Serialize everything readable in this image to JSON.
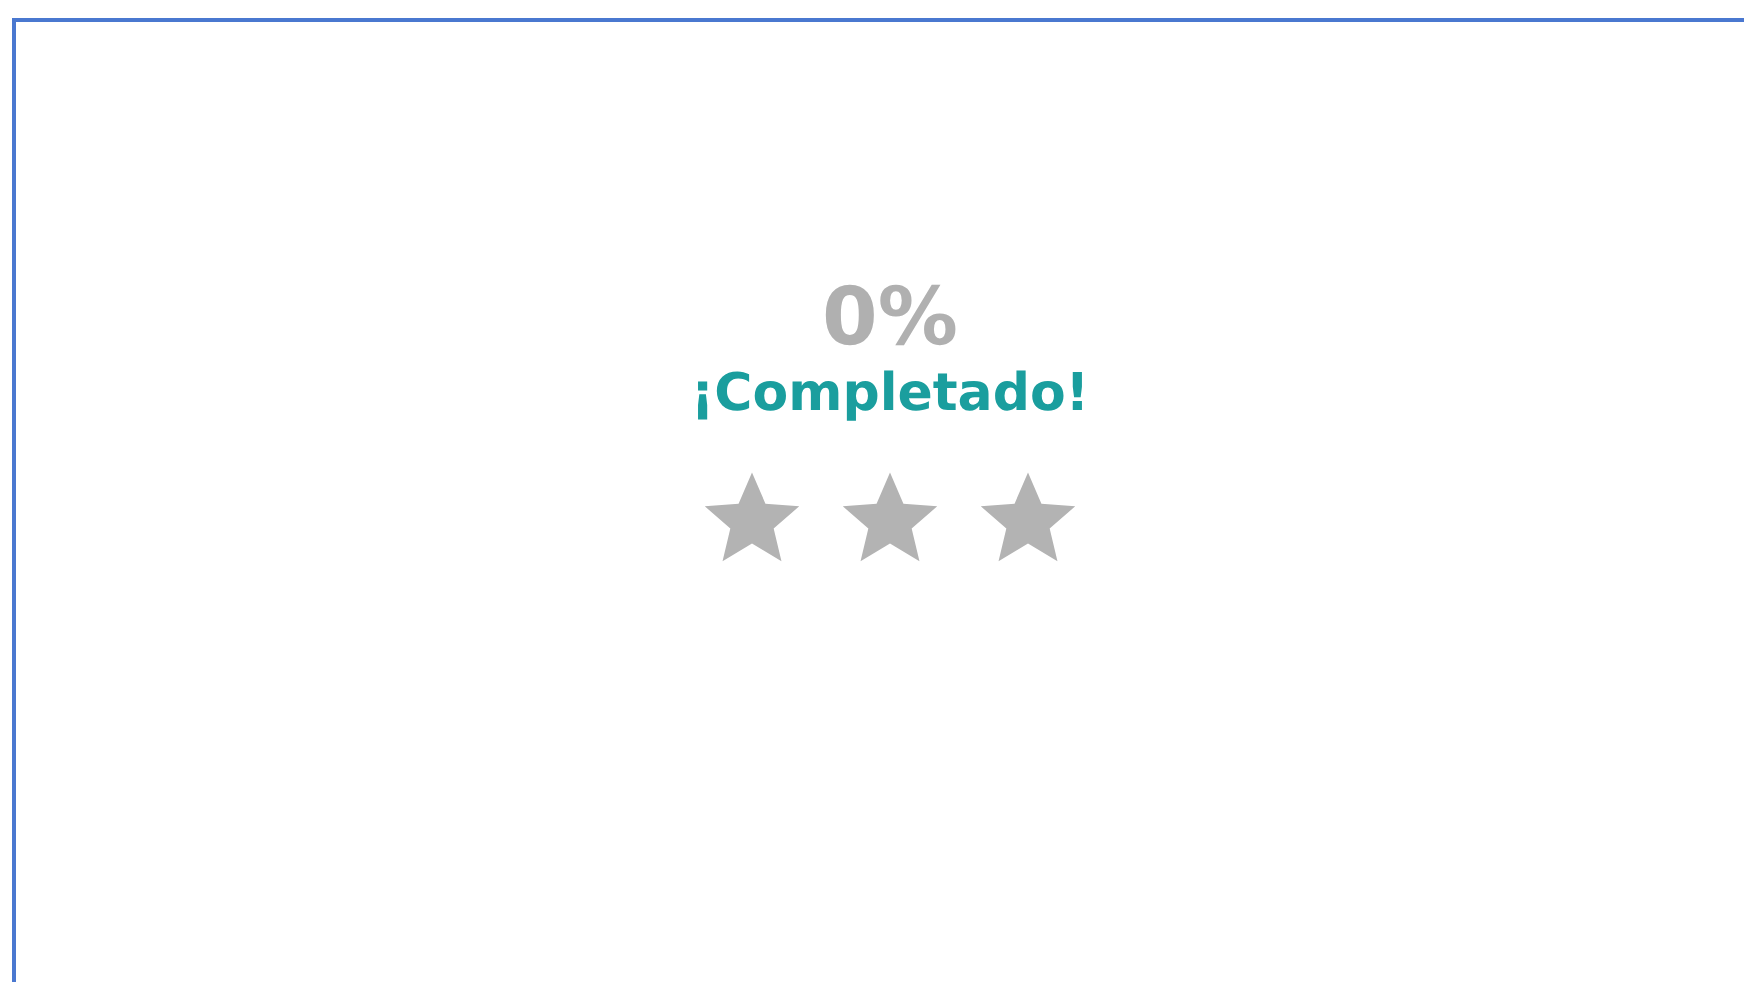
{
  "progress": {
    "percent": "0%",
    "label": "¡Completado!",
    "stars": 0
  }
}
